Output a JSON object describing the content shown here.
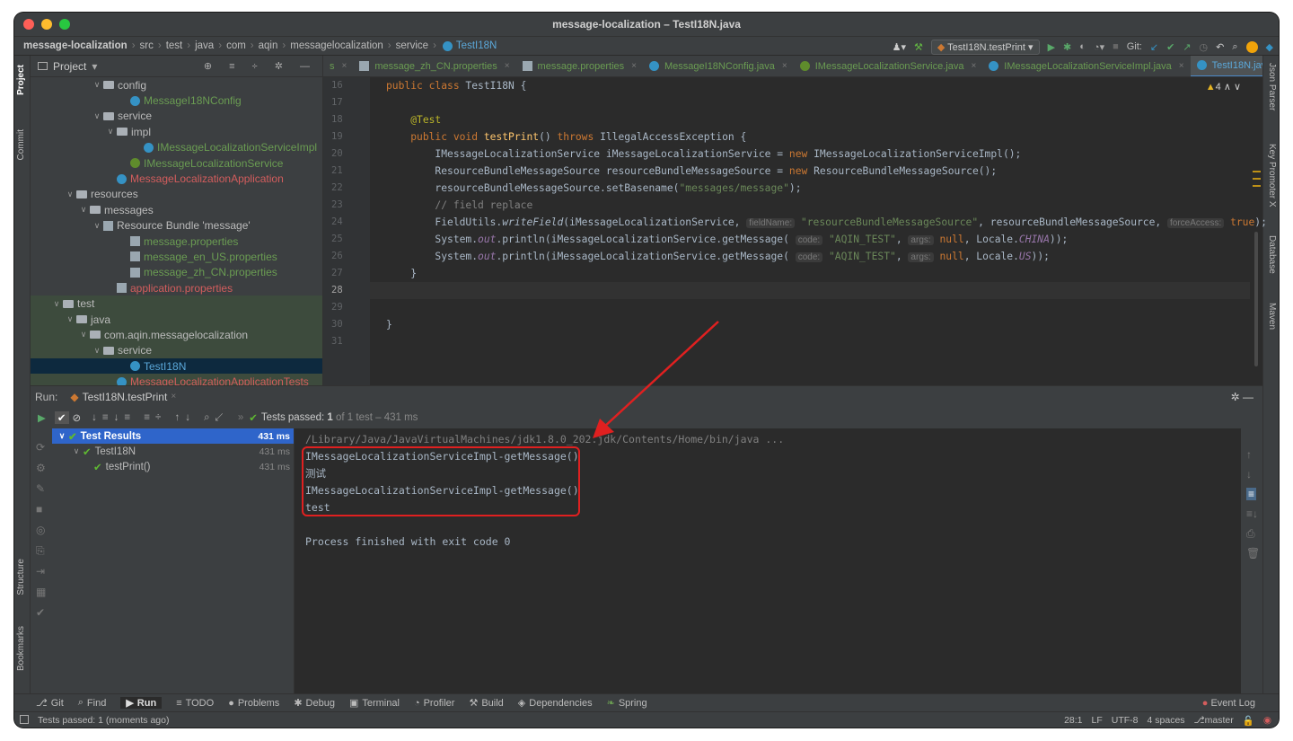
{
  "window": {
    "title": "message-localization – TestI18N.java"
  },
  "breadcrumb": [
    "message-localization",
    "src",
    "test",
    "java",
    "com",
    "aqin",
    "messagelocalization",
    "service",
    "TestI18N"
  ],
  "run_config": "TestI18N.testPrint",
  "git_label": "Git:",
  "left_strip": [
    "Project",
    "Commit",
    "Structure",
    "Bookmarks"
  ],
  "right_strip": [
    "Json Parser",
    "Key Promoter X",
    "Database",
    "Maven"
  ],
  "project": {
    "title": "Project",
    "tree": [
      {
        "label": "config",
        "type": "folder",
        "indent": 5,
        "open": true,
        "color": "grey"
      },
      {
        "label": "MessageI18NConfig",
        "type": "class",
        "indent": 7,
        "color": "green"
      },
      {
        "label": "service",
        "type": "folder",
        "indent": 5,
        "open": true,
        "color": "grey"
      },
      {
        "label": "impl",
        "type": "folder",
        "indent": 6,
        "open": true,
        "color": "grey"
      },
      {
        "label": "IMessageLocalizationServiceImpl",
        "type": "class",
        "indent": 8,
        "color": "green"
      },
      {
        "label": "IMessageLocalizationService",
        "type": "interface",
        "indent": 7,
        "color": "green"
      },
      {
        "label": "MessageLocalizationApplication",
        "type": "class",
        "indent": 6,
        "color": "red"
      },
      {
        "label": "resources",
        "type": "folder",
        "indent": 3,
        "open": true,
        "color": "grey"
      },
      {
        "label": "messages",
        "type": "folder",
        "indent": 4,
        "open": true,
        "color": "grey"
      },
      {
        "label": "Resource Bundle 'message'",
        "type": "bundle",
        "indent": 5,
        "open": true,
        "color": "grey"
      },
      {
        "label": "message.properties",
        "type": "prop",
        "indent": 7,
        "color": "green"
      },
      {
        "label": "message_en_US.properties",
        "type": "prop",
        "indent": 7,
        "color": "green"
      },
      {
        "label": "message_zh_CN.properties",
        "type": "prop",
        "indent": 7,
        "color": "green"
      },
      {
        "label": "application.properties",
        "type": "prop",
        "indent": 6,
        "color": "red"
      },
      {
        "label": "test",
        "type": "folder",
        "indent": 2,
        "open": true,
        "color": "grey",
        "hl": true
      },
      {
        "label": "java",
        "type": "folder",
        "indent": 3,
        "open": true,
        "color": "grey",
        "hl": true
      },
      {
        "label": "com.aqin.messagelocalization",
        "type": "folder",
        "indent": 4,
        "open": true,
        "color": "grey",
        "hl": true
      },
      {
        "label": "service",
        "type": "folder",
        "indent": 5,
        "open": true,
        "color": "grey",
        "hl": true
      },
      {
        "label": "TestI18N",
        "type": "class",
        "indent": 7,
        "color": "blue",
        "sel": true
      },
      {
        "label": "MessageLocalizationApplicationTests",
        "type": "class",
        "indent": 6,
        "color": "red",
        "hl": true
      }
    ]
  },
  "tabs": [
    {
      "label": "s",
      "color": "#6a9c52"
    },
    {
      "label": "message_zh_CN.properties",
      "color": "#6a9c52"
    },
    {
      "label": "message.properties",
      "color": "#6a9c52"
    },
    {
      "label": "MessageI18NConfig.java",
      "color": "#6a9c52"
    },
    {
      "label": "IMessageLocalizationService.java",
      "color": "#6a9c52"
    },
    {
      "label": "IMessageLocalizationServiceImpl.java",
      "color": "#6a9c52"
    },
    {
      "label": "TestI18N.java",
      "color": "#5ba8d9",
      "active": true
    }
  ],
  "editor": {
    "warnings": "4",
    "line_numbers": [
      "16",
      "17",
      "18",
      "19",
      "20",
      "21",
      "22",
      "23",
      "24",
      "25",
      "26",
      "27",
      "28",
      "29",
      "30",
      "31"
    ]
  },
  "run": {
    "label": "Run:",
    "tab": "TestI18N.testPrint",
    "status_prefix": "Tests passed:",
    "status_count": "1",
    "status_suffix": "of 1 test – 431 ms",
    "results": [
      {
        "label": "Test Results",
        "time": "431 ms",
        "indent": 0,
        "sel": true
      },
      {
        "label": "TestI18N",
        "time": "431 ms",
        "indent": 1
      },
      {
        "label": "testPrint()",
        "time": "431 ms",
        "indent": 2
      }
    ],
    "console": [
      "/Library/Java/JavaVirtualMachines/jdk1.8.0_202.jdk/Contents/Home/bin/java ...",
      "IMessageLocalizationServiceImpl-getMessage()",
      "测试",
      "IMessageLocalizationServiceImpl-getMessage()",
      "test",
      "",
      "Process finished with exit code 0"
    ]
  },
  "bottom_tools": [
    "Git",
    "Find",
    "Run",
    "TODO",
    "Problems",
    "Debug",
    "Terminal",
    "Profiler",
    "Build",
    "Dependencies",
    "Spring"
  ],
  "event_log": "Event Log",
  "status": {
    "message": "Tests passed: 1 (moments ago)",
    "position": "28:1",
    "line_sep": "LF",
    "encoding": "UTF-8",
    "indent": "4 spaces",
    "branch": "master"
  }
}
